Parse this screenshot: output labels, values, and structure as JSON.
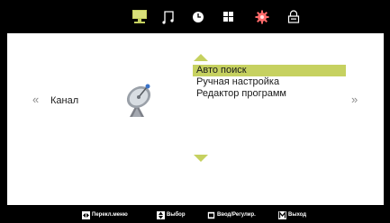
{
  "top_tabs": [
    {
      "icon": "monitor-icon",
      "active": true
    },
    {
      "icon": "music-note-icon",
      "active": false
    },
    {
      "icon": "clock-icon",
      "active": false
    },
    {
      "icon": "grid-icon",
      "active": false
    },
    {
      "icon": "gear-icon",
      "active": false
    },
    {
      "icon": "lock-icon",
      "active": false
    }
  ],
  "colors": {
    "accent": "#c6d160",
    "gear": "#ff6b6b",
    "panel": "#ffffff",
    "background": "#000000"
  },
  "section": {
    "prev_glyph": "«",
    "title": "Канал",
    "next_glyph": "»",
    "icon": "satellite-dish-icon"
  },
  "menu": {
    "items": [
      {
        "label": "Авто поиск",
        "selected": true
      },
      {
        "label": "Ручная настройка",
        "selected": false
      },
      {
        "label": "Редактор программ",
        "selected": false
      }
    ]
  },
  "footer": {
    "hints": [
      {
        "key_icon": "left-right-arrows-icon",
        "label": "Перекл.меню"
      },
      {
        "key_icon": "up-down-arrows-icon",
        "label": "Выбор"
      },
      {
        "key_icon": "ok-key-icon",
        "label": "Ввод/Регулир."
      },
      {
        "key_icon": "menu-key-icon",
        "label": "Выход"
      }
    ]
  }
}
